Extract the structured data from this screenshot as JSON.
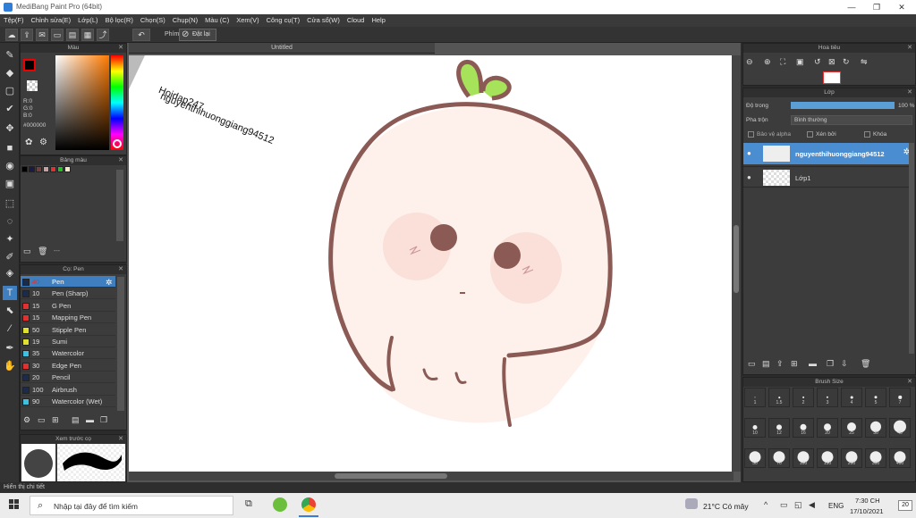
{
  "window": {
    "title": "MediBang Paint Pro (64bit)",
    "minimize": "—",
    "maximize": "❐",
    "close": "✕"
  },
  "menu": [
    "Tệp(F)",
    "Chỉnh sửa(E)",
    "Lớp(L)",
    "Bộ lọc(R)",
    "Chọn(S)",
    "Chụp(N)",
    "Màu (C)",
    "Xem(V)",
    "Công cụ(T)",
    "Cửa sổ(W)",
    "Cloud",
    "Help"
  ],
  "toolbar": {
    "phim_label": "Phím",
    "reset_label": "Đặt lại"
  },
  "color_panel": {
    "title": "Màu",
    "r": "R:0",
    "g": "G:0",
    "b": "B:0",
    "hex": "#000000",
    "accent": "#ff7a00"
  },
  "palette_panel": {
    "title": "Bảng màu",
    "swatches": [
      "#000000",
      "#1a1a4a",
      "#7a3b3b",
      "#c9a0a0",
      "#e03030",
      "#20c020",
      "#f5e6c8"
    ],
    "more": "---"
  },
  "brush_panel": {
    "title": "Cọ: Pen",
    "items": [
      {
        "size": "40",
        "name": "Pen",
        "color": "#1c2b4a",
        "selected": true
      },
      {
        "size": "10",
        "name": "Pen (Sharp)",
        "color": "#1c2b4a"
      },
      {
        "size": "15",
        "name": "G Pen",
        "color": "#e03030"
      },
      {
        "size": "15",
        "name": "Mapping Pen",
        "color": "#e03030"
      },
      {
        "size": "50",
        "name": "Stipple Pen",
        "color": "#e0e030"
      },
      {
        "size": "19",
        "name": "Sumi",
        "color": "#e0e030"
      },
      {
        "size": "35",
        "name": "Watercolor",
        "color": "#40c0e0"
      },
      {
        "size": "30",
        "name": "Edge Pen",
        "color": "#e03030"
      },
      {
        "size": "20",
        "name": "Pencil",
        "color": "#1c2b4a"
      },
      {
        "size": "100",
        "name": "Airbrush",
        "color": "#1c2b4a"
      },
      {
        "size": "90",
        "name": "Watercolor (Wet)",
        "color": "#40c0e0"
      }
    ]
  },
  "preview_panel": {
    "title": "Xem trước cọ"
  },
  "canvas": {
    "tab_title": "Untitled",
    "watermark1": "nguyenthihuonggiang94512",
    "watermark2": "Hoidap247"
  },
  "navigator_panel": {
    "title": "Hoa tiêu"
  },
  "layer_panel": {
    "title": "Lớp",
    "opacity_label": "Độ trong",
    "opacity_value": "100 %",
    "blend_label": "Pha trộn",
    "blend_value": "Bình thường",
    "protect_alpha": "Bảo vệ alpha",
    "clip": "Xén bởi",
    "lock": "Khóa",
    "layers": [
      {
        "name": "nguyenthihuonggiang94512",
        "selected": true
      },
      {
        "name": "Lớp1",
        "selected": false
      }
    ]
  },
  "brushsize_panel": {
    "title": "Brush Size",
    "sizes": [
      "1",
      "1.5",
      "2",
      "3",
      "4",
      "5",
      "7",
      "10",
      "12",
      "16",
      "20",
      "25",
      "30",
      "40",
      "50",
      "70",
      "100",
      "150",
      "200",
      "300",
      "400"
    ]
  },
  "status": {
    "text": "Hiển thị chi tiết"
  },
  "taskbar": {
    "search_placeholder": "Nhập tại đây để tìm kiếm",
    "weather": "21°C  Có mây",
    "lang": "ENG",
    "time": "7:30 CH",
    "date": "17/10/2021",
    "notif": "20"
  }
}
